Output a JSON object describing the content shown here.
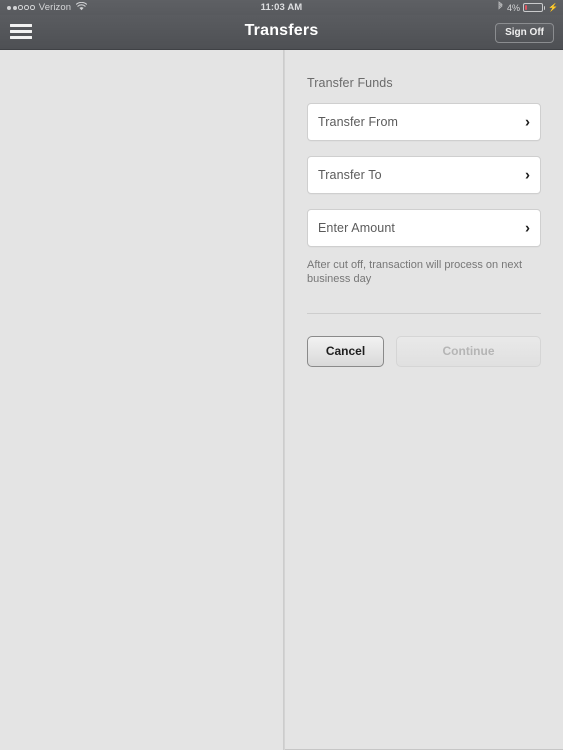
{
  "status_bar": {
    "carrier": "Verizon",
    "signal_filled": 2,
    "signal_empty": 3,
    "wifi_icon": "wifi-icon",
    "time": "11:03 AM",
    "bluetooth_icon": "bluetooth-icon",
    "battery_percent": "4%",
    "battery_level": 4,
    "charging_icon": "lightning-bolt-icon",
    "battery_color": "#e05561"
  },
  "nav_bar": {
    "menu_icon": "hamburger-menu-icon",
    "title": "Transfers",
    "sign_off_label": "Sign Off"
  },
  "transfer_form": {
    "section_title": "Transfer Funds",
    "fields": [
      {
        "label": "Transfer From",
        "chevron": "chevron-right-icon"
      },
      {
        "label": "Transfer To",
        "chevron": "chevron-right-icon"
      },
      {
        "label": "Enter Amount",
        "chevron": "chevron-right-icon"
      }
    ],
    "note": "After cut off, transaction will process on next business day",
    "cancel_label": "Cancel",
    "continue_label": "Continue"
  },
  "colors": {
    "nav_bar": "#54565a",
    "page_background": "#e4e4e4",
    "field_background": "#ffffff",
    "accent_battery": "#e05561"
  }
}
